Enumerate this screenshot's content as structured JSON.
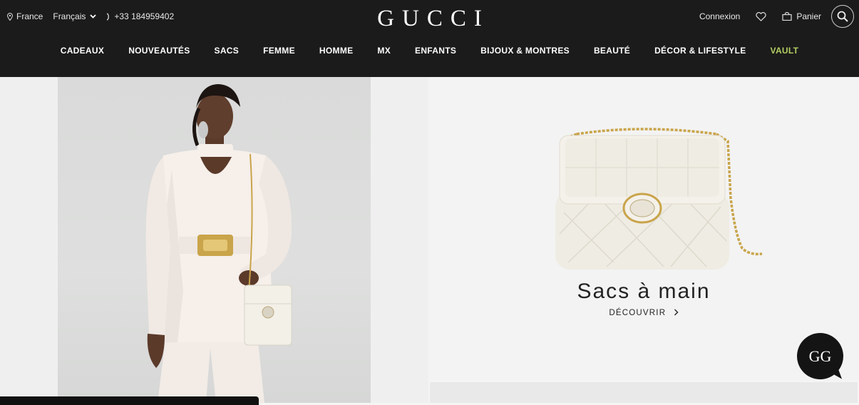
{
  "header": {
    "country": "France",
    "language": "Français",
    "phone": "+33 184959402",
    "logo": "GUCCI",
    "login": "Connexion",
    "cart": "Panier"
  },
  "nav": [
    {
      "label": "CADEAUX"
    },
    {
      "label": "NOUVEAUTÉS"
    },
    {
      "label": "SACS"
    },
    {
      "label": "FEMME"
    },
    {
      "label": "HOMME"
    },
    {
      "label": "MX"
    },
    {
      "label": "ENFANTS"
    },
    {
      "label": "BIJOUX & MONTRES"
    },
    {
      "label": "BEAUTÉ"
    },
    {
      "label": "DÉCOR & LIFESTYLE"
    },
    {
      "label": "VAULT"
    }
  ],
  "promo": {
    "title": "Sacs à main",
    "cta": "DÉCOUVRIR"
  },
  "chat": {
    "label": "GG"
  },
  "colors": {
    "header_bg": "#1b1b1b",
    "vault": "#b4cf62"
  }
}
